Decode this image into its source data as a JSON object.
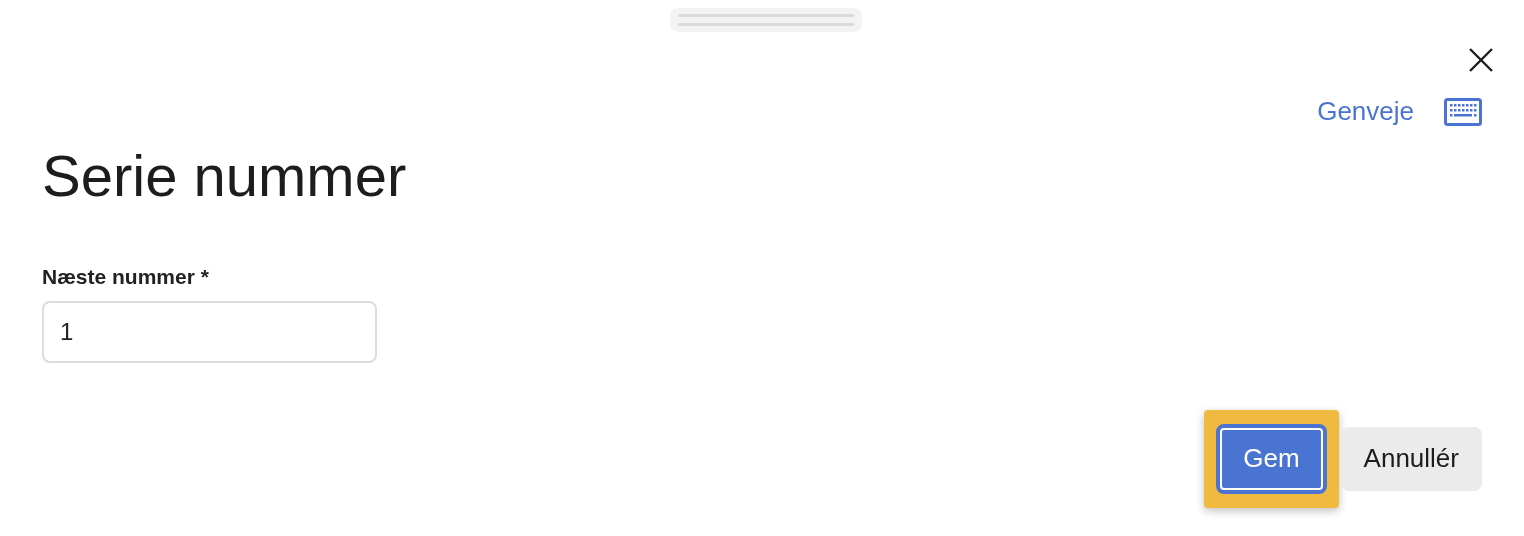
{
  "dialog": {
    "shortcuts_link": "Genveje",
    "title": "Serie nummer"
  },
  "field": {
    "label": "Næste nummer *",
    "value": "1"
  },
  "buttons": [
    {
      "label": "Gem",
      "kind": "primary",
      "focused": true
    },
    {
      "label": "Annullér",
      "kind": "secondary",
      "focused": false
    }
  ]
}
